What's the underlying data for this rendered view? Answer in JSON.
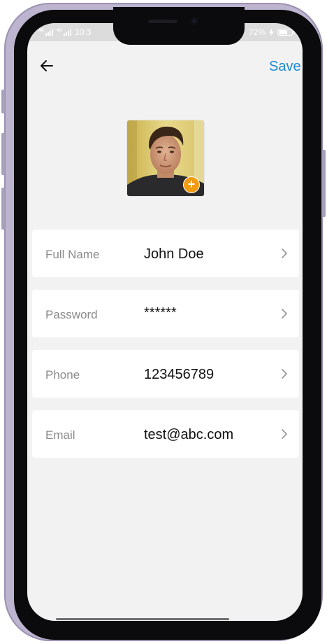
{
  "status_bar": {
    "network_left": "4G",
    "network_right": "4G",
    "time": "10:3",
    "battery": "72%",
    "battery_level": 0.72
  },
  "header": {
    "back_icon": "arrow-left-icon",
    "save_label": "Save",
    "accent_color": "#1c8ad0"
  },
  "profile": {
    "add_photo_symbol": "+",
    "add_icon_color": "#f39a13"
  },
  "fields": [
    {
      "label": "Full Name",
      "value": "John Doe"
    },
    {
      "label": "Password",
      "value": "******"
    },
    {
      "label": "Phone",
      "value": "123456789"
    },
    {
      "label": "Email",
      "value": "test@abc.com"
    }
  ]
}
